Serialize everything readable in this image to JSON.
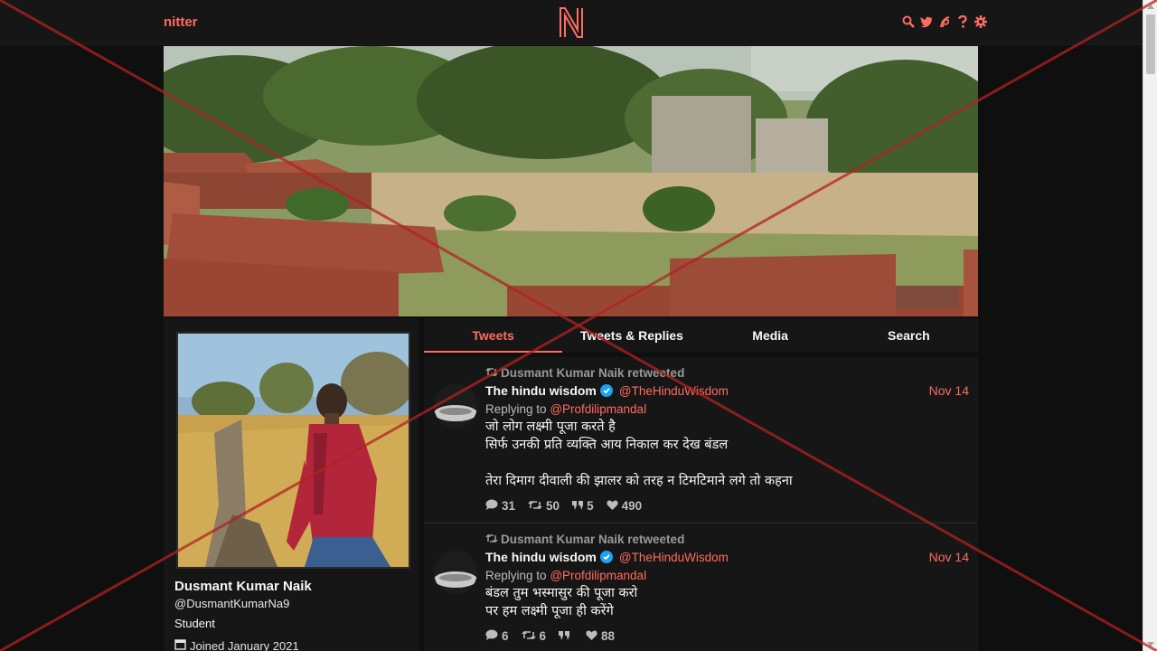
{
  "nav": {
    "brand": "nitter",
    "logo_letter": "N"
  },
  "nav_icons": [
    "search-icon",
    "twitter-bird-icon",
    "rss-feed-icon",
    "help-icon",
    "gear-icon"
  ],
  "profile": {
    "fullname": "Dusmant Kumar Naik",
    "username": "@DusmantKumarNa9",
    "bio": "Student",
    "joined": "Joined January 2021"
  },
  "tabs": [
    {
      "label": "Tweets",
      "active": true
    },
    {
      "label": "Tweets & Replies",
      "active": false
    },
    {
      "label": "Media",
      "active": false
    },
    {
      "label": "Search",
      "active": false
    }
  ],
  "tweets": [
    {
      "retweet_header": "Dusmant Kumar Naik retweeted",
      "fullname": "The hindu wisdom",
      "username": "@TheHinduWisdom",
      "date": "Nov 14",
      "replying_label": "Replying to",
      "replying_to": "@Profdilipmandal",
      "lines": [
        "जो लोग लक्ष्मी पूजा करते है",
        "सिर्फ उनकी प्रति व्यक्ति आय निकाल कर देख बंडल",
        "",
        "तेरा दिमाग दीवाली की झालर को तरह न टिमटिमाने लगे तो कहना"
      ],
      "stats": {
        "replies": "31",
        "retweets": "50",
        "quotes": "5",
        "likes": "490"
      }
    },
    {
      "retweet_header": "Dusmant Kumar Naik retweeted",
      "fullname": "The hindu wisdom",
      "username": "@TheHinduWisdom",
      "date": "Nov 14",
      "replying_label": "Replying to",
      "replying_to": "@Profdilipmandal",
      "lines": [
        "बंडल तुम भस्मासुर की पूजा करो",
        "पर हम लक्ष्मी पूजा ही करेंगे"
      ],
      "stats": {
        "replies": "6",
        "retweets": "6",
        "quotes": "",
        "likes": "88"
      }
    }
  ],
  "colors": {
    "accent": "#ff6c60",
    "background": "#0f0f0f",
    "panel": "#161616",
    "overlay_x": "#b22222"
  }
}
